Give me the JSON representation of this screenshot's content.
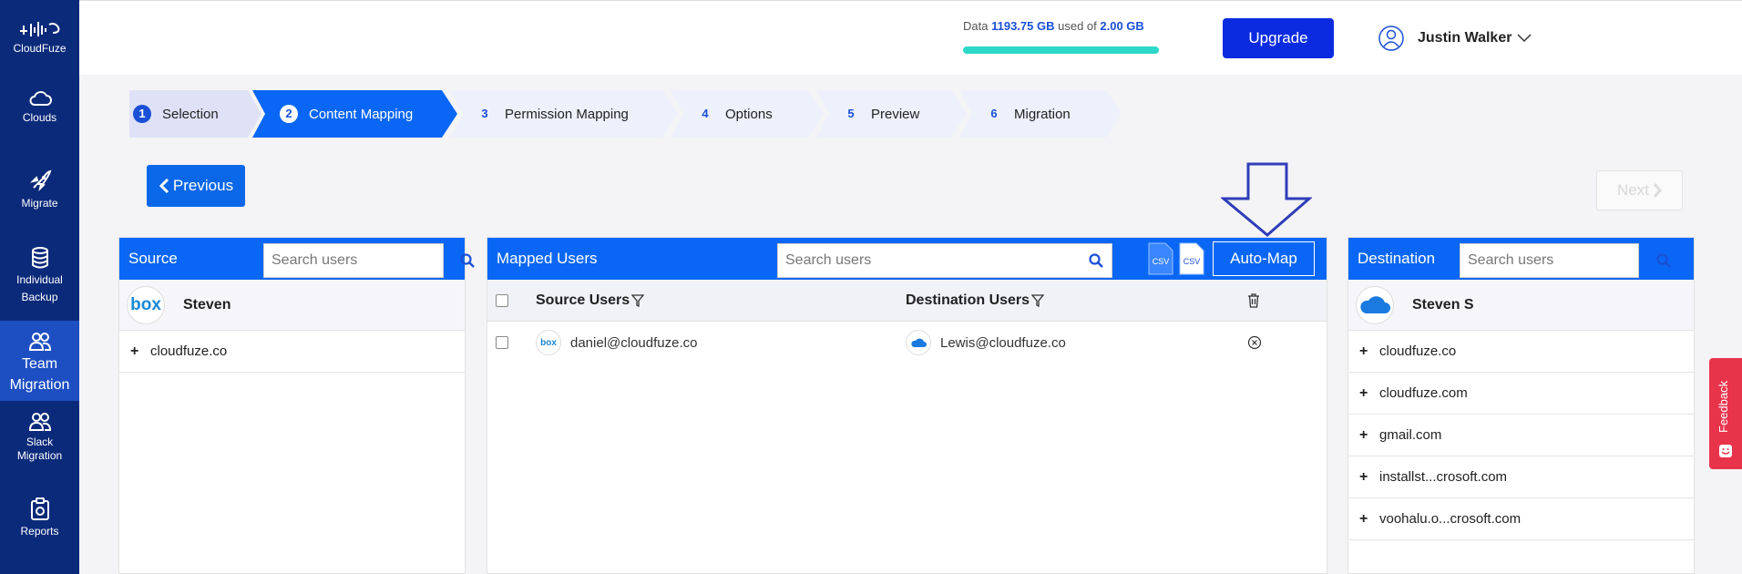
{
  "sidebar": {
    "brand": "CloudFuze",
    "items": [
      {
        "label": "Clouds",
        "icon": "cloud-icon"
      },
      {
        "label": "Migrate",
        "icon": "rocket-icon"
      },
      {
        "label": "Individual",
        "label2": "Backup",
        "icon": "database-icon"
      },
      {
        "label": "Team",
        "label2": "Migration",
        "icon": "team-icon",
        "active": true
      },
      {
        "label": "Slack",
        "label2": "Migration",
        "icon": "slack-team-icon"
      },
      {
        "label": "Reports",
        "icon": "report-icon"
      }
    ]
  },
  "header": {
    "quota_prefix": "Data",
    "quota_used": "1193.75 GB",
    "quota_mid": "used of",
    "quota_total": "2.00 GB",
    "quota_fill": 1.0,
    "upgrade_label": "Upgrade",
    "user_name": "Justin Walker"
  },
  "stepper": [
    {
      "num": "1",
      "label": "Selection",
      "state": "done"
    },
    {
      "num": "2",
      "label": "Content Mapping",
      "state": "active"
    },
    {
      "num": "3",
      "label": "Permission Mapping",
      "state": "todo"
    },
    {
      "num": "4",
      "label": "Options",
      "state": "todo"
    },
    {
      "num": "5",
      "label": "Preview",
      "state": "todo"
    },
    {
      "num": "6",
      "label": "Migration",
      "state": "todo"
    }
  ],
  "nav": {
    "previous_label": "Previous",
    "next_label": "Next"
  },
  "source": {
    "title": "Source",
    "search_placeholder": "Search users",
    "cloud_logo_text": "box",
    "cloud_name": "Steven",
    "domains": [
      "cloudfuze.co"
    ]
  },
  "mapped": {
    "title": "Mapped Users",
    "search_placeholder": "Search users",
    "csv_label": "CSV",
    "automap_label": "Auto-Map",
    "col_source": "Source Users",
    "col_destination": "Destination Users",
    "rows": [
      {
        "source_logo": "box",
        "source": "daniel@cloudfuze.co",
        "destination": "Lewis@cloudfuze.co"
      }
    ]
  },
  "destination": {
    "title": "Destination",
    "search_placeholder": "Search users",
    "cloud_name": "Steven S",
    "domains": [
      "cloudfuze.co",
      "cloudfuze.com",
      "gmail.com",
      "installst...crosoft.com",
      "voohalu.o...crosoft.com"
    ]
  },
  "feedback_label": "Feedback",
  "colors": {
    "sidebar": "#0b2a7a",
    "primary": "#0a67f5",
    "upgrade": "#0a2be0",
    "quota": "#2ed8c8",
    "feedback": "#e8344b"
  }
}
